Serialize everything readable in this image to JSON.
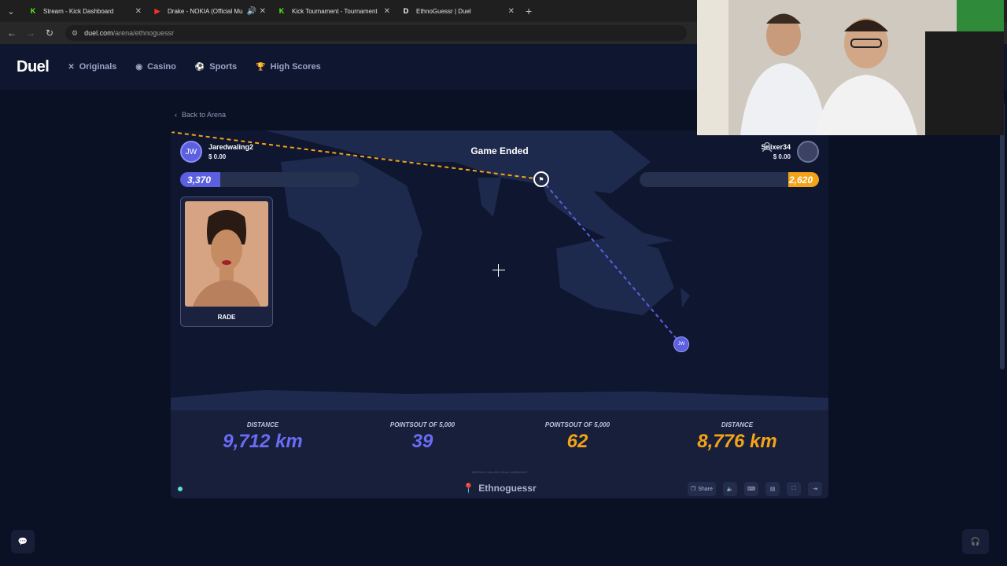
{
  "browser": {
    "tabs": [
      {
        "title": "Stream - Kick Dashboard",
        "icon": "kick-icon"
      },
      {
        "title": "Drake - NOKIA (Official Mu",
        "icon": "youtube-icon"
      },
      {
        "title": "Kick Tournament - Tournament",
        "icon": "kick-icon"
      },
      {
        "title": "EthnoGuessr | Duel",
        "icon": "duel-icon"
      }
    ],
    "url_domain": "duel.com",
    "url_path": "/arena/ethnoguessr"
  },
  "header": {
    "logo": "Duel",
    "nav": [
      "Originals",
      "Casino",
      "Sports",
      "High Scores"
    ]
  },
  "back_label": "Back to Arena",
  "game": {
    "status": "Game Ended",
    "player1": {
      "initials": "JW",
      "name": "Jaredwaling2",
      "balance": "$ 0.00",
      "score": "3,370",
      "score_fraction": 0.674
    },
    "player2": {
      "name": "Snixer34",
      "balance": "$ 0.00",
      "score": "2,620",
      "score_fraction": 0.524
    },
    "hint_label": "RADE",
    "guess_pin_label": "JW",
    "stats": {
      "p1_distance_label": "DISTANCE",
      "p1_distance": "9,712 km",
      "p1_points_label": "POINTSOUT OF 5,000",
      "p1_points": "39",
      "p2_points_label": "POINTSOUT OF 5,000",
      "p2_points": "62",
      "p2_distance_label": "DISTANCE",
      "p2_distance": "8,776 km"
    },
    "game_id": "8f839b0e-1e6a-4fb2-94ae-1c6f3f8d2a7f",
    "title": "Ethnoguessr",
    "share_label": "Share"
  },
  "colors": {
    "p1": "#5b5fe0",
    "p2": "#f4a317",
    "bg": "#0b1124"
  }
}
